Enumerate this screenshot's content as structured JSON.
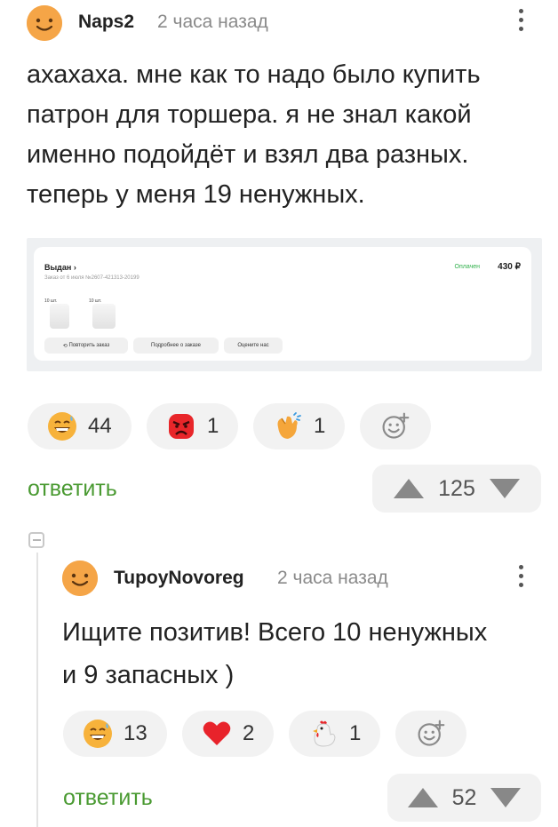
{
  "comments": [
    {
      "username": "Naps2",
      "time": "2 часа назад",
      "text_lines": [
        "ахахаха. мне как то надо было купить",
        "патрон для торшера. я не знал какой",
        "именно подойдёт и взял два разных.",
        "теперь у меня 19 ненужных."
      ],
      "attachment": {
        "status": "Выдан",
        "order_line": "Заказ от 6 июля №2607-421313-20199",
        "paid": "Оплачен",
        "sum": "430 ₽",
        "qty_1": "10 шт.",
        "qty_2": "10 шт.",
        "btn_repeat": "Повторить заказ",
        "btn_details": "Подробнее о заказе",
        "btn_rate": "Оцените нас"
      },
      "reactions": [
        {
          "icon": "grinning-sweat-emoji",
          "count": "44"
        },
        {
          "icon": "angry-face-emoji",
          "count": "1"
        },
        {
          "icon": "clapping-hands-emoji",
          "count": "1"
        }
      ],
      "reply_label": "ответить",
      "rating": "125"
    },
    {
      "username": "TupoyNovoreg",
      "time": "2 часа назад",
      "text_lines": [
        "Ищите позитив! Всего 10 ненужных",
        "и 9 запасных )"
      ],
      "reactions": [
        {
          "icon": "grinning-sweat-emoji",
          "count": "13"
        },
        {
          "icon": "red-heart-emoji",
          "count": "2"
        },
        {
          "icon": "chicken-emoji",
          "count": "1"
        }
      ],
      "reply_label": "ответить",
      "rating": "52"
    }
  ],
  "colors": {
    "avatar": "#f5a547",
    "reply_link": "#4a9a32",
    "pill_bg": "#f2f2f2"
  }
}
